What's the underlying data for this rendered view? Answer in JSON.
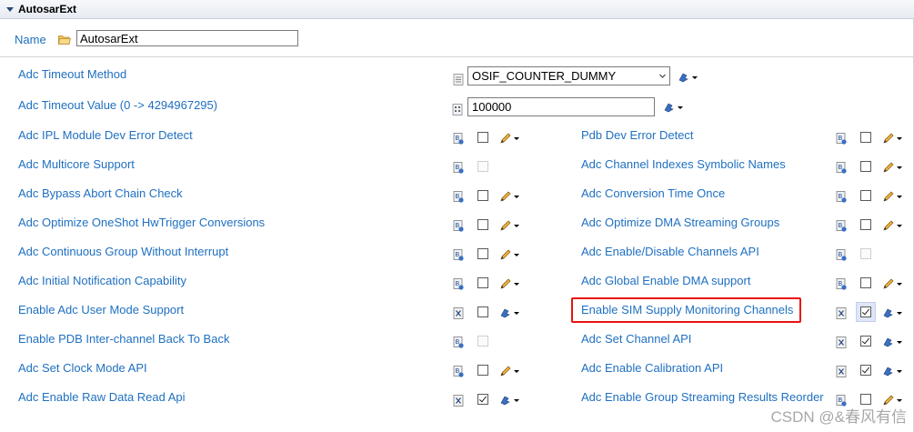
{
  "section": {
    "title": "AutosarExt"
  },
  "name_row": {
    "label": "Name",
    "value": "AutosarExt"
  },
  "timeout_method": {
    "label": "Adc Timeout Method",
    "selected": "OSIF_COUNTER_DUMMY"
  },
  "timeout_value": {
    "label": "Adc Timeout Value (0 -> 4294967295)",
    "value": "100000"
  },
  "left_params": [
    {
      "label": "Adc IPL Module Dev Error Detect",
      "state": "unchecked",
      "icon_type": "boolean-icon",
      "tool": "pencil-icon"
    },
    {
      "label": "Adc Multicore Support",
      "state": "disabled",
      "icon_type": "boolean-icon",
      "tool": ""
    },
    {
      "label": "Adc Bypass Abort Chain Check",
      "state": "unchecked",
      "icon_type": "boolean-icon",
      "tool": "pencil-icon"
    },
    {
      "label": "Adc Optimize OneShot HwTrigger Conversions",
      "state": "unchecked",
      "icon_type": "boolean-icon",
      "tool": "pencil-icon"
    },
    {
      "label": "Adc Continuous Group Without Interrupt",
      "state": "unchecked",
      "icon_type": "boolean-icon",
      "tool": "pencil-icon"
    },
    {
      "label": "Adc Initial Notification Capability",
      "state": "unchecked",
      "icon_type": "boolean-icon",
      "tool": "pencil-icon"
    },
    {
      "label": "Enable Adc User Mode Support",
      "state": "unchecked",
      "icon_type": "formula-icon",
      "tool": "calc-icon"
    },
    {
      "label": "Enable PDB Inter-channel Back To Back",
      "state": "disabled",
      "icon_type": "boolean-icon",
      "tool": ""
    },
    {
      "label": "Adc Set Clock Mode API",
      "state": "unchecked",
      "icon_type": "boolean-icon",
      "tool": "pencil-icon"
    },
    {
      "label": "Adc Enable Raw Data Read Api",
      "state": "checked",
      "icon_type": "formula-icon",
      "tool": "calc-icon"
    }
  ],
  "right_params": [
    {
      "label": "Pdb Dev Error Detect",
      "state": "unchecked",
      "icon_type": "boolean-icon",
      "tool": "pencil-icon"
    },
    {
      "label": "Adc Channel Indexes Symbolic Names",
      "state": "unchecked",
      "icon_type": "boolean-icon",
      "tool": "pencil-icon"
    },
    {
      "label": "Adc Conversion Time Once",
      "state": "unchecked",
      "icon_type": "boolean-icon",
      "tool": "pencil-icon"
    },
    {
      "label": "Adc Optimize DMA Streaming Groups",
      "state": "unchecked",
      "icon_type": "boolean-icon",
      "tool": "pencil-icon"
    },
    {
      "label": "Adc Enable/Disable Channels API",
      "state": "disabled",
      "icon_type": "boolean-icon",
      "tool": ""
    },
    {
      "label": "Adc Global Enable DMA support",
      "state": "unchecked",
      "icon_type": "boolean-icon",
      "tool": "pencil-icon"
    },
    {
      "label": "Enable SIM Supply Monitoring Channels",
      "state": "checked",
      "icon_type": "formula-icon",
      "tool": "calc-icon",
      "highlighted": true
    },
    {
      "label": "Adc Set Channel API",
      "state": "checked",
      "icon_type": "formula-icon",
      "tool": "calc-icon"
    },
    {
      "label": "Adc Enable Calibration API",
      "state": "checked",
      "icon_type": "formula-icon",
      "tool": "calc-icon"
    },
    {
      "label": "Adc Enable Group Streaming Results Reorder",
      "state": "unchecked",
      "icon_type": "boolean-icon",
      "tool": "pencil-icon"
    }
  ],
  "colors": {
    "label": "#1f70c1",
    "highlight": "#e8130f",
    "header_bg": "#e6ebf2"
  },
  "watermark": "CSDN @&春风有信"
}
